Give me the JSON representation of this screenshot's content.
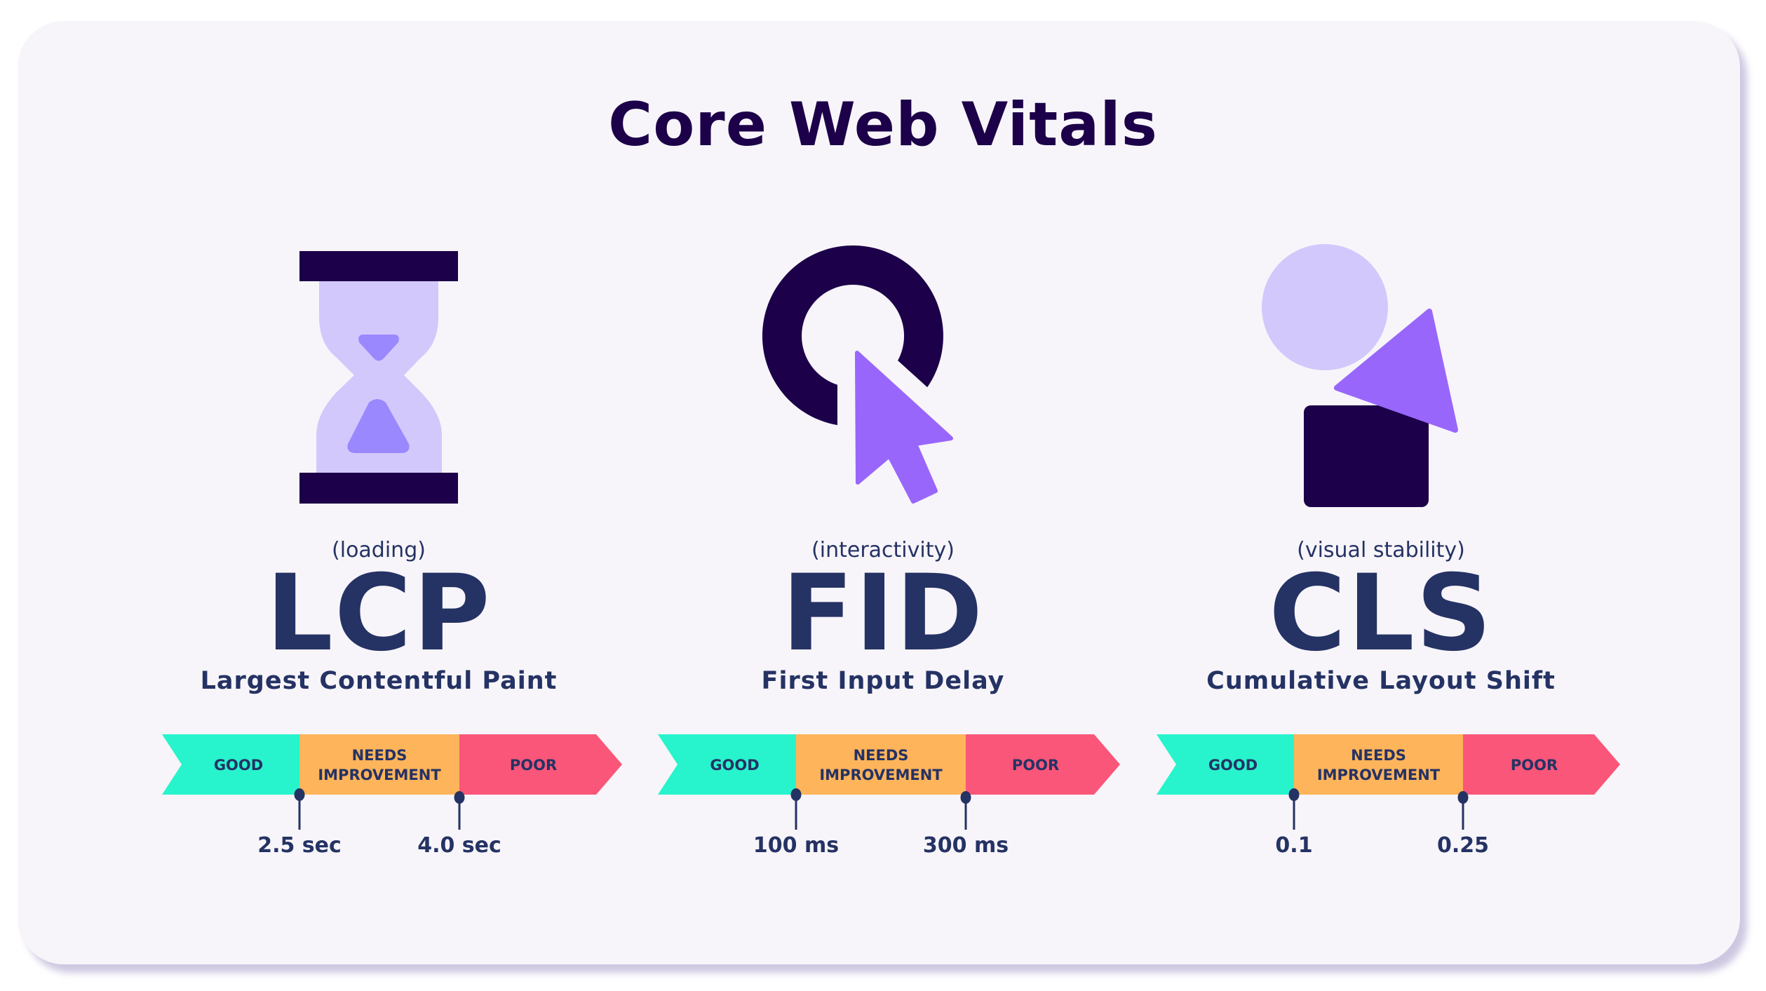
{
  "title": "Core Web Vitals",
  "colors": {
    "dark": "#1c0049",
    "text": "#253264",
    "lavender": "#d3c8fc",
    "violet": "#9a88ff",
    "purple": "#9966fc",
    "good": "#27f4cd",
    "needs_improvement": "#feb45a",
    "poor": "#fa5679",
    "card_bg": "#f7f5f9"
  },
  "metrics": [
    {
      "icon": "hourglass-icon",
      "category": "(loading)",
      "abbr": "LCP",
      "name": "Largest Contentful Paint",
      "segments": [
        "GOOD",
        "NEEDS IMPROVEMENT",
        "POOR"
      ],
      "thresholds": [
        "2.5 sec",
        "4.0 sec"
      ]
    },
    {
      "icon": "cursor-click-icon",
      "category": "(interactivity)",
      "abbr": "FID",
      "name": "First Input Delay",
      "segments": [
        "GOOD",
        "NEEDS IMPROVEMENT",
        "POOR"
      ],
      "thresholds": [
        "100 ms",
        "300 ms"
      ]
    },
    {
      "icon": "shapes-shift-icon",
      "category": "(visual stability)",
      "abbr": "CLS",
      "name": "Cumulative Layout Shift",
      "segments": [
        "GOOD",
        "NEEDS IMPROVEMENT",
        "POOR"
      ],
      "thresholds": [
        "0.1",
        "0.25"
      ]
    }
  ]
}
